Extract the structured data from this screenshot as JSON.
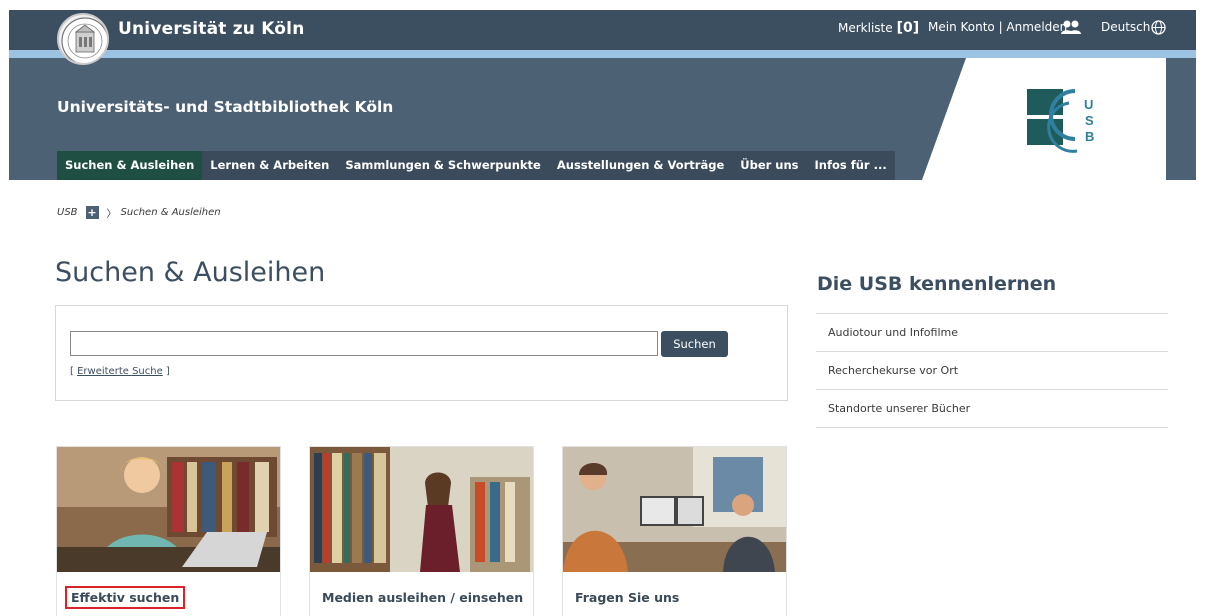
{
  "topbar": {
    "university": "Universität zu Köln",
    "merkliste_label": "Merkliste",
    "merkliste_count": "[0]",
    "account_label": "Mein Konto | Anmelden",
    "language_label": "Deutsch"
  },
  "header": {
    "library_name": "Universitäts- und Stadtbibliothek Köln",
    "logo_letters": "USB"
  },
  "mainnav": {
    "items": [
      {
        "label": "Suchen & Ausleihen",
        "active": true
      },
      {
        "label": "Lernen & Arbeiten"
      },
      {
        "label": "Sammlungen & Schwerpunkte"
      },
      {
        "label": "Ausstellungen & Vorträge"
      },
      {
        "label": "Über uns"
      },
      {
        "label": "Infos für ..."
      }
    ]
  },
  "breadcrumb": {
    "root": "USB",
    "plus": "+",
    "current": "Suchen & Ausleihen"
  },
  "main": {
    "title": "Suchen & Ausleihen",
    "search": {
      "value": "",
      "button_label": "Suchen",
      "advanced_prefix": "[ ",
      "advanced_label": "Erweiterte Suche",
      "advanced_suffix": " ]"
    },
    "cards": [
      {
        "label": "Effektiv suchen",
        "highlighted": true
      },
      {
        "label": "Medien ausleihen / einsehen"
      },
      {
        "label": "Fragen Sie uns"
      }
    ]
  },
  "sidebar": {
    "title": "Die USB kennenlernen",
    "items": [
      {
        "label": "Audiotour und Infofilme"
      },
      {
        "label": "Recherchekurse vor Ort"
      },
      {
        "label": "Standorte unserer Bücher"
      }
    ]
  },
  "colors": {
    "topbar": "#3c4f61",
    "stripe": "#9dc3e2",
    "header": "#4d6174",
    "nav_active": "#1f4f43",
    "highlight_box": "#d8232a"
  }
}
